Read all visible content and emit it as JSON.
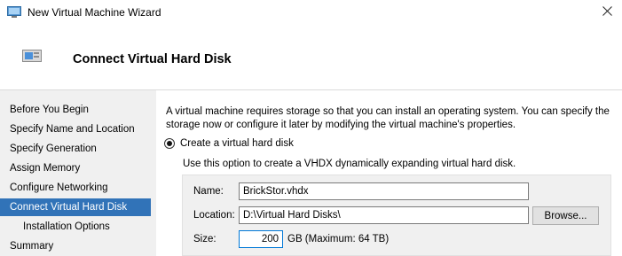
{
  "window": {
    "title": "New Virtual Machine Wizard",
    "close_glyph": "✕",
    "icon": "hyper-v-window-icon"
  },
  "header": {
    "title": "Connect Virtual Hard Disk",
    "icon": "wizard-page-icon"
  },
  "nav": {
    "items": [
      {
        "label": "Before You Begin",
        "selected": false,
        "sub": false
      },
      {
        "label": "Specify Name and Location",
        "selected": false,
        "sub": false
      },
      {
        "label": "Specify Generation",
        "selected": false,
        "sub": false
      },
      {
        "label": "Assign Memory",
        "selected": false,
        "sub": false
      },
      {
        "label": "Configure Networking",
        "selected": false,
        "sub": false
      },
      {
        "label": "Connect Virtual Hard Disk",
        "selected": true,
        "sub": false
      },
      {
        "label": "Installation Options",
        "selected": false,
        "sub": true
      },
      {
        "label": "Summary",
        "selected": false,
        "sub": false
      }
    ],
    "selected_color": "#3173b8"
  },
  "content": {
    "description": "A virtual machine requires storage so that you can install an operating system. You can specify the storage now or configure it later by modifying the virtual machine's properties.",
    "option_create": {
      "label": "Create a virtual hard disk",
      "selected": true,
      "description": "Use this option to create a VHDX dynamically expanding virtual hard disk."
    },
    "fields": {
      "name_label": "Name:",
      "name_value": "BrickStor.vhdx",
      "location_label": "Location:",
      "location_value": "D:\\Virtual Hard Disks\\",
      "browse_label": "Browse...",
      "size_label": "Size:",
      "size_value": "200",
      "size_unit": "GB (Maximum: 64 TB)"
    }
  }
}
